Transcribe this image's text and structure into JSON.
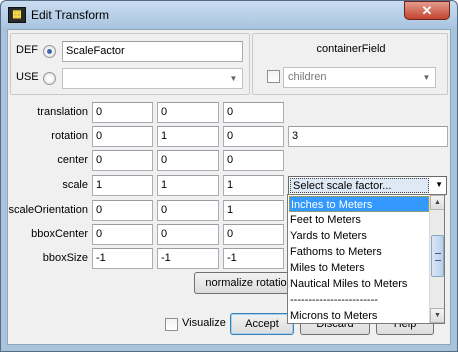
{
  "window": {
    "title": "Edit Transform",
    "close_glyph": "✕",
    "app_icon": "x3d-edit-icon"
  },
  "def_use": {
    "def_label": "DEF",
    "def_value": "ScaleFactor",
    "use_label": "USE",
    "use_value": ""
  },
  "container_field": {
    "label": "containerField",
    "value": "children"
  },
  "fields": {
    "translation": {
      "label": "translation",
      "values": [
        "0",
        "0",
        "0"
      ]
    },
    "rotation": {
      "label": "rotation",
      "values": [
        "0",
        "1",
        "0",
        "3"
      ]
    },
    "center": {
      "label": "center",
      "values": [
        "0",
        "0",
        "0"
      ]
    },
    "scale": {
      "label": "scale",
      "values": [
        "1",
        "1",
        "1"
      ]
    },
    "scaleOrientation": {
      "label": "scaleOrientation",
      "values": [
        "0",
        "0",
        "1"
      ]
    },
    "bboxCenter": {
      "label": "bboxCenter",
      "values": [
        "0",
        "0",
        "0"
      ]
    },
    "bboxSize": {
      "label": "bboxSize",
      "values": [
        "-1",
        "-1",
        "-1"
      ]
    }
  },
  "scale_factor": {
    "selected": "Select scale factor...",
    "options": [
      "Inches to Meters",
      "Feet to Meters",
      "Yards to Meters",
      "Fathoms to Meters",
      "Miles to Meters",
      "Nautical Miles to Meters",
      "------------------------",
      "Microns to Meters"
    ],
    "highlighted_index": 0
  },
  "buttons": {
    "normalize": "normalize rotatio",
    "visualize": "Visualize",
    "accept": "Accept",
    "discard": "Discard",
    "help": "Help"
  },
  "colors": {
    "selection": "#3399ff",
    "titlebar": "#a9c4e0"
  }
}
